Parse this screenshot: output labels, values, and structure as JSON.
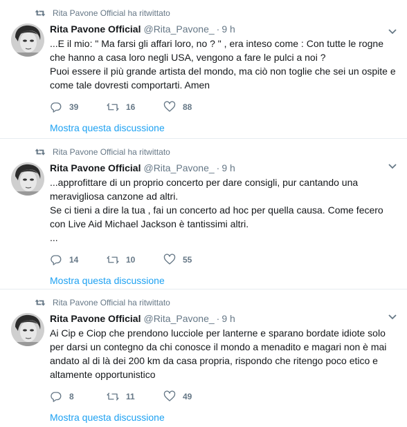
{
  "tweets": [
    {
      "context": "Rita Pavone Official ha ritwittato",
      "fullname": "Rita Pavone Official",
      "username": "@Rita_Pavone_",
      "time": "9 h",
      "lines": [
        "...E il mio: \" Ma farsi gli affari loro, no ? \" , era inteso come : Con tutte le rogne che hanno a casa loro negli USA, vengono a fare le pulci a noi ?",
        "Puoi essere il più  grande artista del mondo, ma ciò  non toglie che sei un ospite e come tale dovresti  comportarti.  Amen"
      ],
      "replies": "39",
      "retweets": "16",
      "likes": "88",
      "thread_link": "Mostra questa discussione"
    },
    {
      "context": "Rita Pavone Official ha ritwittato",
      "fullname": "Rita Pavone Official",
      "username": "@Rita_Pavone_",
      "time": "9 h",
      "lines": [
        "...approfittare di un proprio concerto per dare consigli, pur cantando una meravigliosa canzone ad altri.",
        "Se ci tieni a dire la tua , fai un concerto ad hoc per quella causa. Come fecero con Live Aid Michael Jackson è tantissimi altri.",
        "..."
      ],
      "replies": "14",
      "retweets": "10",
      "likes": "55",
      "thread_link": "Mostra questa discussione"
    },
    {
      "context": "Rita Pavone Official ha ritwittato",
      "fullname": "Rita Pavone Official",
      "username": "@Rita_Pavone_",
      "time": "9 h",
      "lines": [
        "Ai Cip e Ciop che prendono lucciole  per lanterne e sparano bordate idiote solo per darsi un contegno da chi conosce il mondo a menadito e  magari non è mai andato al di là dei 200 km da casa propria, rispondo  che ritengo poco etico e altamente opportunistico"
      ],
      "replies": "8",
      "retweets": "11",
      "likes": "49",
      "thread_link": "Mostra questa discussione"
    }
  ],
  "colors": {
    "link": "#1da1f2",
    "secondary_text": "#657786",
    "primary_text": "#14171a",
    "divider": "#e6ecf0"
  },
  "icons": {
    "context": "retweet-icon",
    "reply": "reply-icon",
    "retweet": "retweet-icon",
    "like": "heart-icon",
    "menu": "chevron-down-icon"
  }
}
